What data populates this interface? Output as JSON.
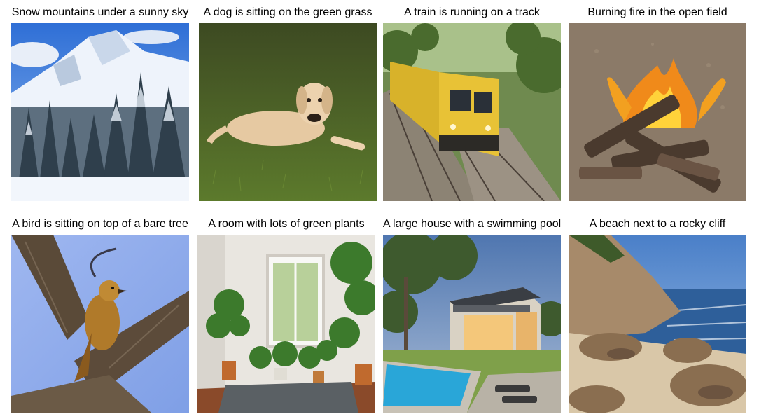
{
  "gallery": {
    "items": [
      {
        "caption": "Snow mountains under a sunny sky",
        "image": "snowy-mountain-forest"
      },
      {
        "caption": "A dog is sitting on the green grass",
        "image": "dog-on-grass"
      },
      {
        "caption": "A train is running on a track",
        "image": "yellow-train-on-track"
      },
      {
        "caption": "Burning fire in the open field",
        "image": "campfire"
      },
      {
        "caption": "A bird is sitting on top of a bare tree",
        "image": "bird-on-branch"
      },
      {
        "caption": "A room with lots of green plants",
        "image": "room-with-plants"
      },
      {
        "caption": "A large house with a swimming pool",
        "image": "house-with-pool"
      },
      {
        "caption": "A beach next to a rocky cliff",
        "image": "beach-and-cliff"
      }
    ]
  }
}
